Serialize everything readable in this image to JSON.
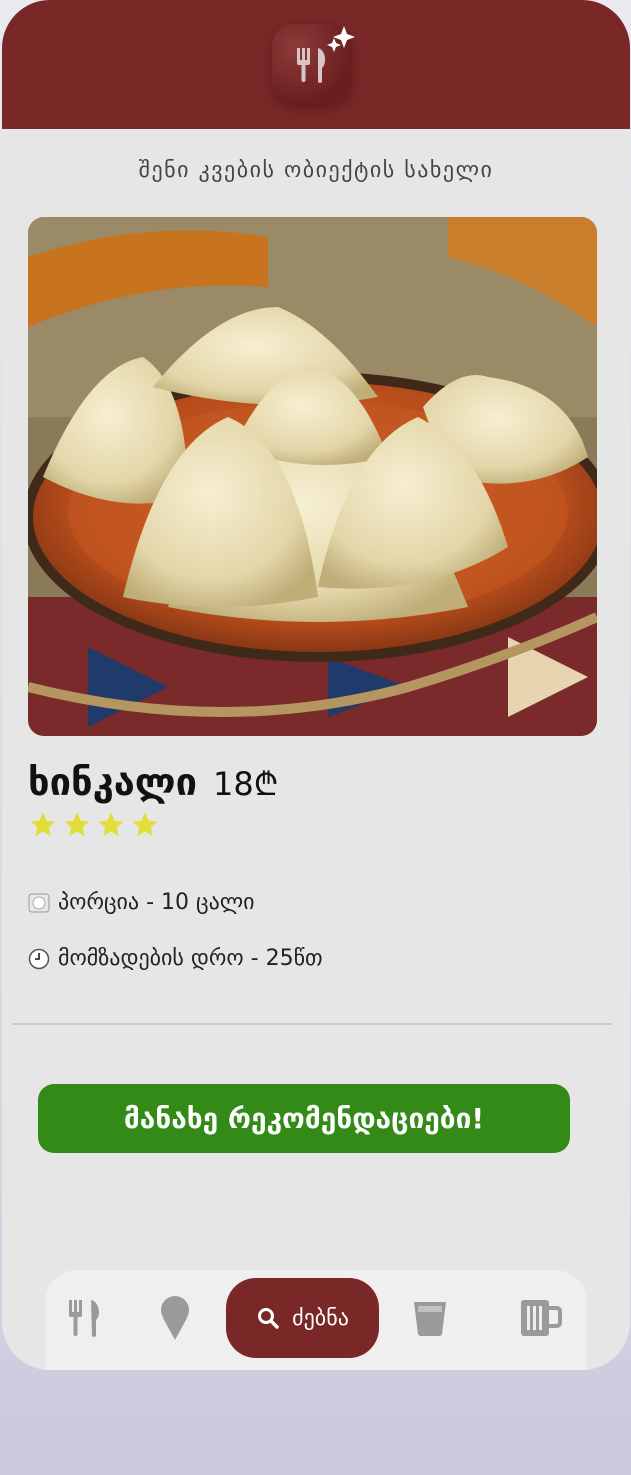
{
  "header": {
    "logo_icon": "fork-knife-sparkle-icon",
    "bg_color": "#7a2727"
  },
  "venue": {
    "name": "შენი კვების ობიექტის სახელი"
  },
  "dish": {
    "image_alt": "khinkali dumplings on clay plate",
    "name": "ხინკალი",
    "price": "18₾",
    "rating": 4,
    "rating_max": 4,
    "star_color": "#e3dd3a"
  },
  "info": {
    "portion_icon": "plate-icon",
    "portion": "პორცია - 10 ცალი",
    "time_icon": "clock-icon",
    "time": "მომზადების დრო -  25წთ"
  },
  "cta": {
    "label": "მანახე რეკომენდაციები!",
    "color": "#348a17"
  },
  "tabs": [
    {
      "icon": "fork-knife-icon",
      "label": ""
    },
    {
      "icon": "ice-cream-icon",
      "label": ""
    },
    {
      "icon": "search-icon",
      "label": "ძებნა",
      "active": true
    },
    {
      "icon": "glass-icon",
      "label": ""
    },
    {
      "icon": "beer-mug-icon",
      "label": ""
    }
  ]
}
